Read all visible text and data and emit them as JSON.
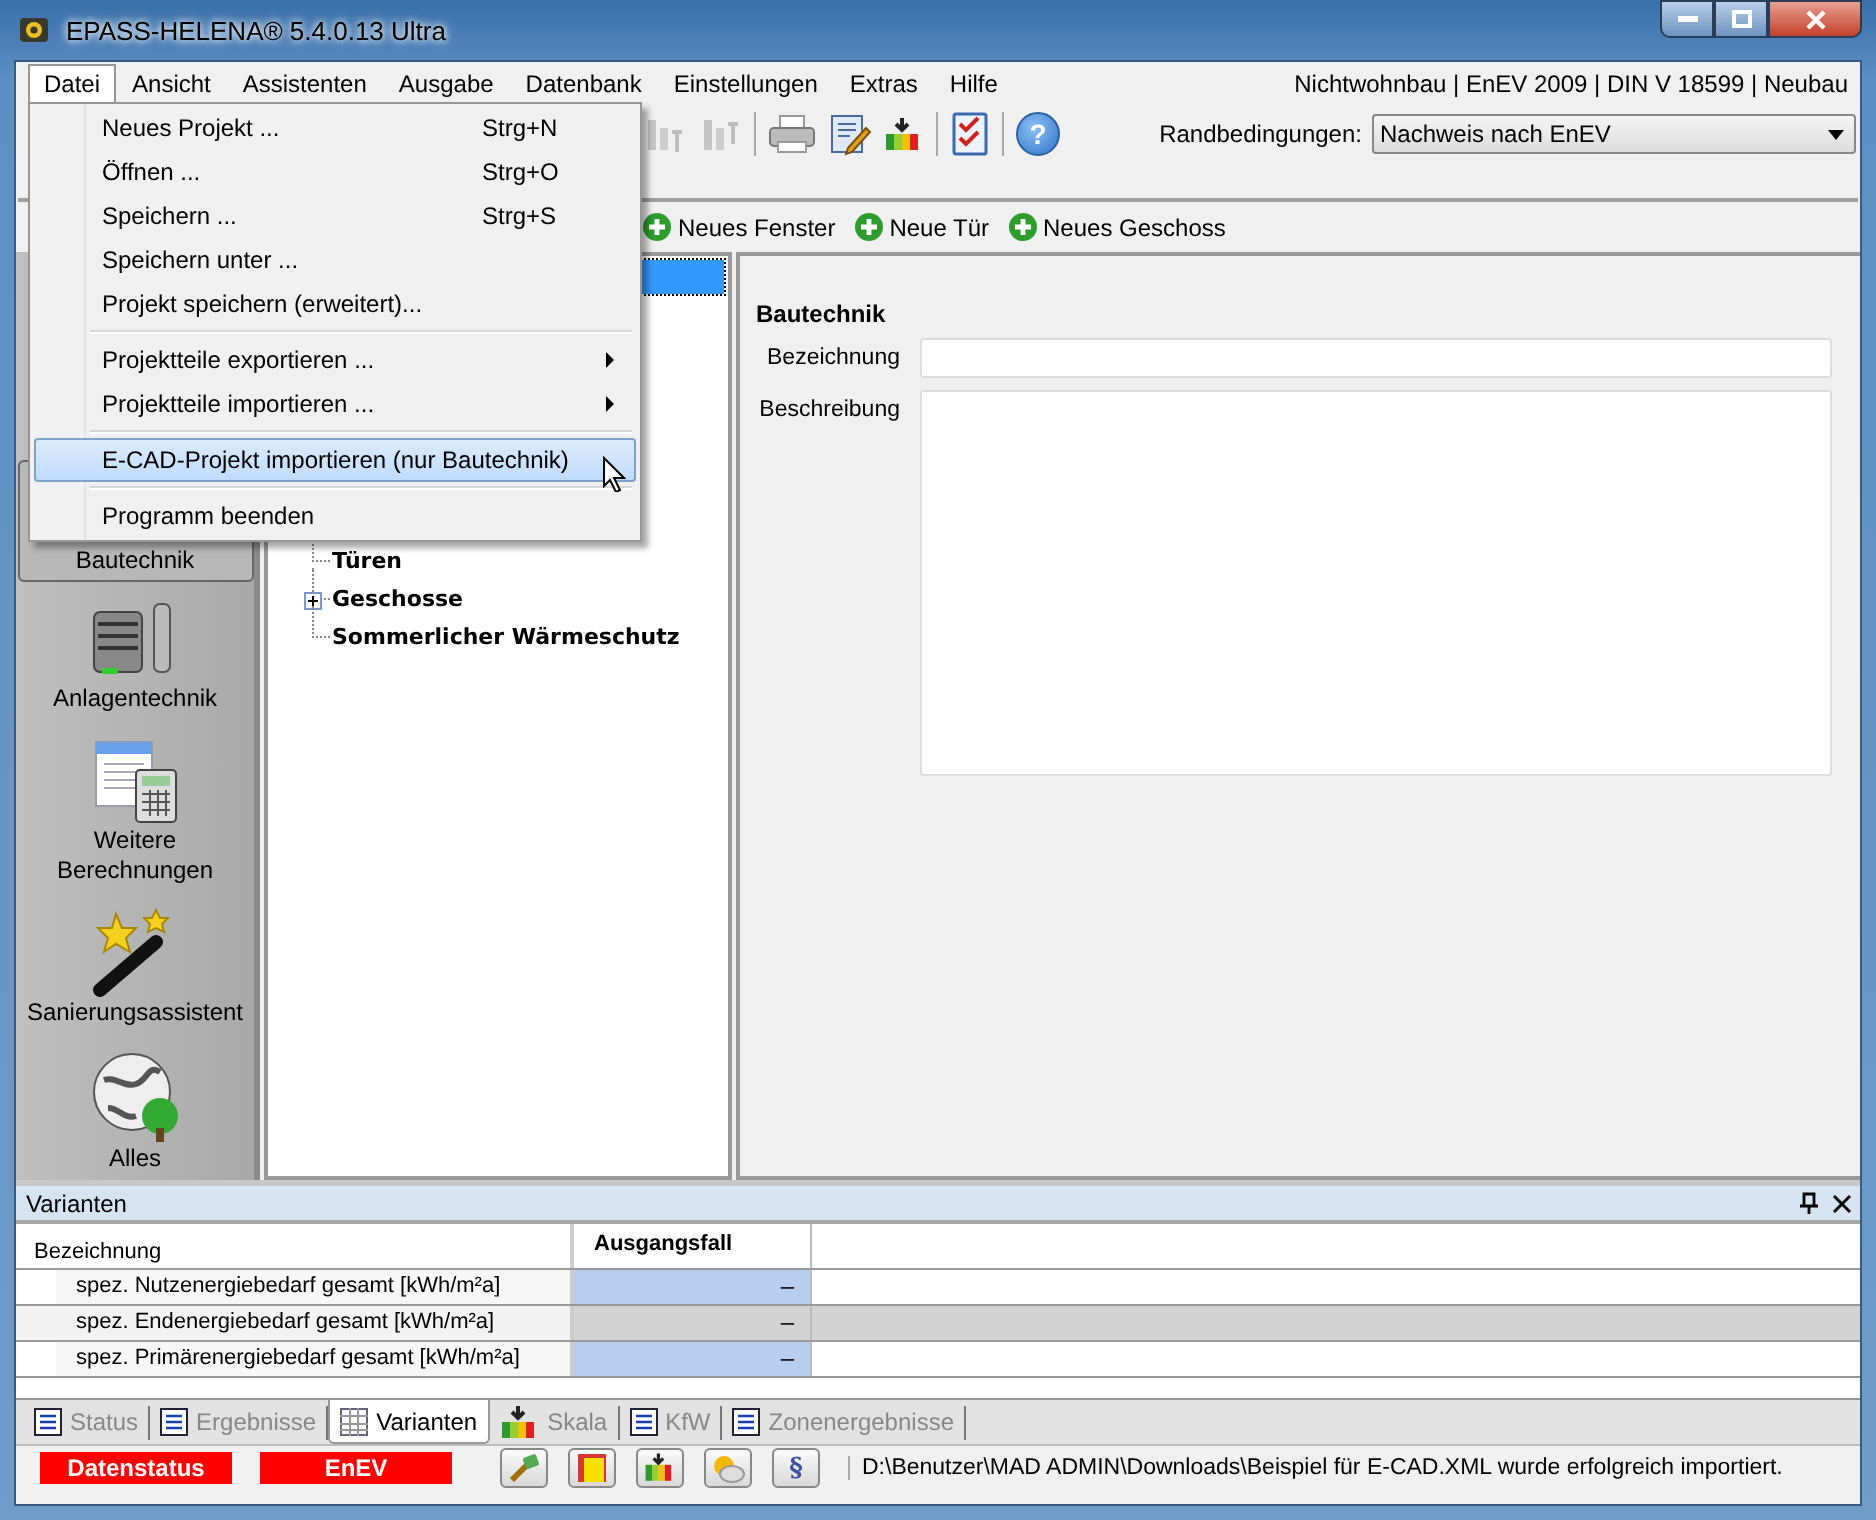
{
  "window": {
    "title": "EPASS-HELENA® 5.4.0.13 Ultra"
  },
  "menu_bar": [
    {
      "label": "Datei",
      "selected": true
    },
    {
      "label": "Ansicht",
      "selected": false
    },
    {
      "label": "Assistenten",
      "selected": false
    },
    {
      "label": "Ausgabe",
      "selected": false
    },
    {
      "label": "Datenbank",
      "selected": false
    },
    {
      "label": "Einstellungen",
      "selected": false
    },
    {
      "label": "Extras",
      "selected": false
    },
    {
      "label": "Hilfe",
      "selected": false
    }
  ],
  "project_info": "Nichtwohnbau | EnEV 2009 | DIN V 18599 | Neubau",
  "randbedingungen": {
    "label": "Randbedingungen:",
    "value": "Nachweis nach EnEV"
  },
  "toolbar": [
    {
      "kind": "bars",
      "disabled": true
    },
    {
      "kind": "bars-down",
      "disabled": true
    },
    {
      "kind": "separator"
    },
    {
      "kind": "printer",
      "disabled": false
    },
    {
      "kind": "edit",
      "disabled": false
    },
    {
      "kind": "scale",
      "disabled": false
    },
    {
      "kind": "separator"
    },
    {
      "kind": "checklist",
      "disabled": false
    },
    {
      "kind": "separator"
    },
    {
      "kind": "help",
      "disabled": false,
      "symbol": "?"
    }
  ],
  "actions": [
    "Neues Fenster",
    "Neue Tür",
    "Neues Geschoss"
  ],
  "sidebar": [
    {
      "label": "Bautechnik",
      "kind": "building",
      "selected": true
    },
    {
      "label": "Anlagentechnik",
      "kind": "plant",
      "selected": false
    },
    {
      "label": "Weitere Berechnungen",
      "kind": "calc",
      "selected": false
    },
    {
      "label": "Sanierungsassistent",
      "kind": "wand",
      "selected": false
    },
    {
      "label": "Alles",
      "kind": "globe",
      "selected": false
    }
  ],
  "tree": [
    {
      "label": "Türen",
      "expandable": false
    },
    {
      "label": "Geschosse",
      "expandable": true
    },
    {
      "label": "Sommerlicher Wärmeschutz",
      "expandable": false
    }
  ],
  "form": {
    "title": "Bautechnik",
    "fields": [
      {
        "label": "Bezeichnung",
        "kind": "line"
      },
      {
        "label": "Beschreibung",
        "kind": "area"
      }
    ]
  },
  "file_menu": [
    {
      "kind": "item",
      "label": "Neues Projekt ...",
      "shortcut": "Strg+N",
      "submenu": false,
      "selected": false
    },
    {
      "kind": "item",
      "label": "Öffnen ...",
      "shortcut": "Strg+O",
      "submenu": false,
      "selected": false
    },
    {
      "kind": "item",
      "label": "Speichern ...",
      "shortcut": "Strg+S",
      "submenu": false,
      "selected": false
    },
    {
      "kind": "item",
      "label": "Speichern unter ...",
      "submenu": false,
      "selected": false
    },
    {
      "kind": "item",
      "label": "Projekt speichern (erweitert)...",
      "submenu": false,
      "selected": false
    },
    {
      "kind": "separator"
    },
    {
      "kind": "item",
      "label": "Projektteile exportieren ...",
      "submenu": true,
      "selected": false
    },
    {
      "kind": "item",
      "label": "Projektteile importieren ...",
      "submenu": true,
      "selected": false
    },
    {
      "kind": "separator"
    },
    {
      "kind": "item",
      "label": "E-CAD-Projekt importieren (nur Bautechnik)",
      "submenu": false,
      "selected": true
    },
    {
      "kind": "separator"
    },
    {
      "kind": "item",
      "label": "Programm beenden",
      "submenu": false,
      "selected": false
    }
  ],
  "variants_panel": {
    "title": "Varianten",
    "columns": [
      "Bezeichnung",
      "Ausgangsfall"
    ],
    "rows": [
      {
        "label": "spez. Nutzenergiebedarf gesamt [kWh/m²a]",
        "value": "–",
        "selected": false
      },
      {
        "label": "spez. Endenergiebedarf gesamt [kWh/m²a]",
        "value": "–",
        "selected": true
      },
      {
        "label": "spez. Primärenergiebedarf gesamt [kWh/m²a]",
        "value": "–",
        "selected": false
      }
    ]
  },
  "bottom_tabs": [
    {
      "label": "Status",
      "kind": "list",
      "selected": false
    },
    {
      "label": "Ergebnisse",
      "kind": "list",
      "selected": false
    },
    {
      "label": "Varianten",
      "kind": "table",
      "selected": true
    },
    {
      "label": "Skala",
      "kind": "scale",
      "selected": false
    },
    {
      "label": "KfW",
      "kind": "list",
      "selected": false
    },
    {
      "label": "Zonenergebnisse",
      "kind": "list",
      "selected": false
    }
  ],
  "status_bar": {
    "badges": [
      "Datenstatus",
      "EnEV"
    ],
    "buttons": [
      {
        "kind": "tools"
      },
      {
        "kind": "square"
      },
      {
        "kind": "scale"
      },
      {
        "kind": "weather"
      },
      {
        "kind": "paragraph",
        "symbol": "§"
      }
    ],
    "message": "D:\\Benutzer\\MAD ADMIN\\Downloads\\Beispiel für E-CAD.XML wurde erfolgreich importiert."
  }
}
